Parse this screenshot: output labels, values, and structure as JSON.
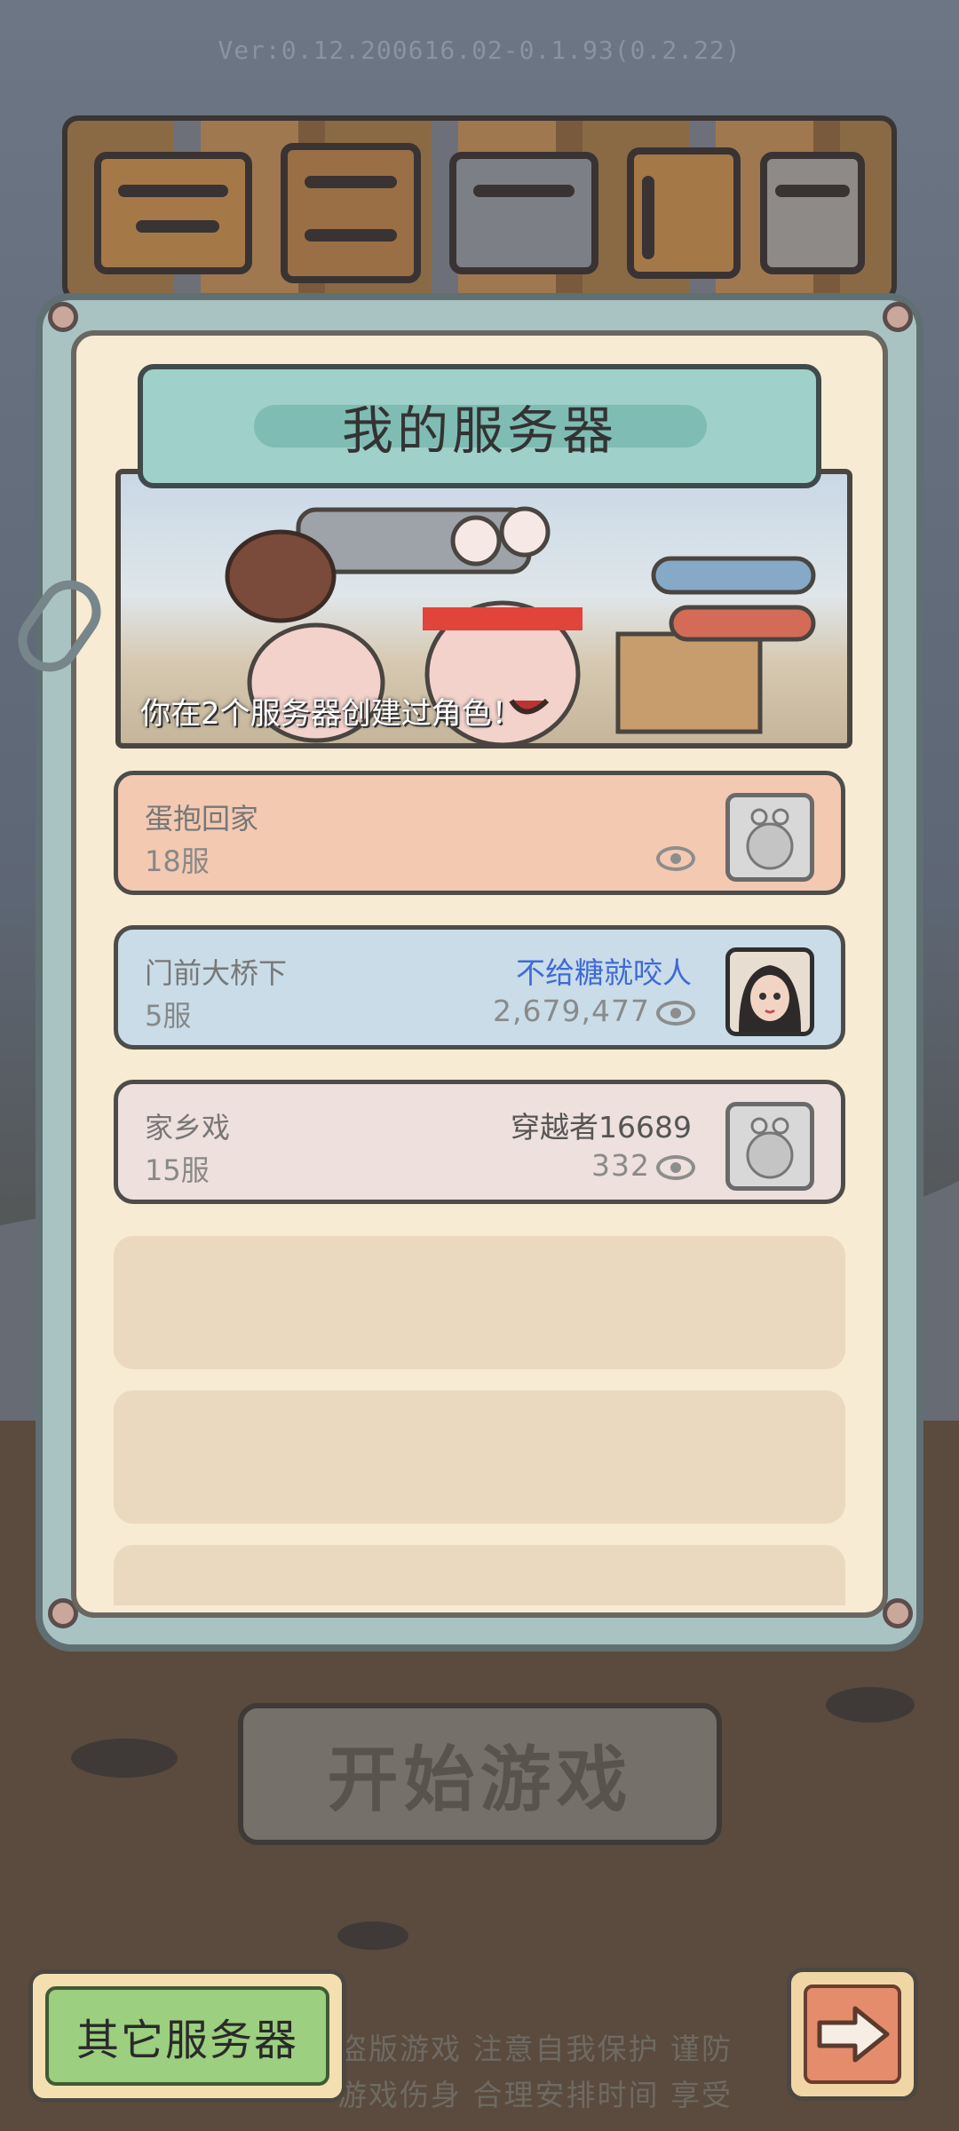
{
  "version": "Ver:0.12.200616.02-0.1.93(0.2.22)",
  "panel": {
    "title": "我的服务器",
    "banner_text": "你在2个服务器创建过角色！"
  },
  "servers": [
    {
      "name": "蛋抱回家",
      "server": "18服",
      "character": "",
      "power": "",
      "avatar": "snail-placeholder-icon"
    },
    {
      "name": "门前大桥下",
      "server": "5服",
      "character": "不给糖就咬人",
      "power": "2,679,477",
      "avatar": "character-portrait"
    },
    {
      "name": "家乡戏",
      "server": "15服",
      "character": "穿越者16689",
      "power": "332",
      "avatar": "snail-placeholder-icon"
    }
  ],
  "start_button": "开始游戏",
  "notice_lines": [
    "盗版游戏  注意自我保护  谨防",
    "游戏伤身  合理安排时间  享受"
  ],
  "other_servers_button": "其它服务器",
  "next_button_icon": "right-arrow-icon",
  "colors": {
    "header": "#9fd0c9",
    "row_recent": "#f3c9b2",
    "row_selected": "#c9dce8",
    "row_default": "#eee0dc",
    "character_highlight": "#3f6ad6",
    "other_button": "#9ccf7f",
    "next_button": "#e48c6c"
  }
}
